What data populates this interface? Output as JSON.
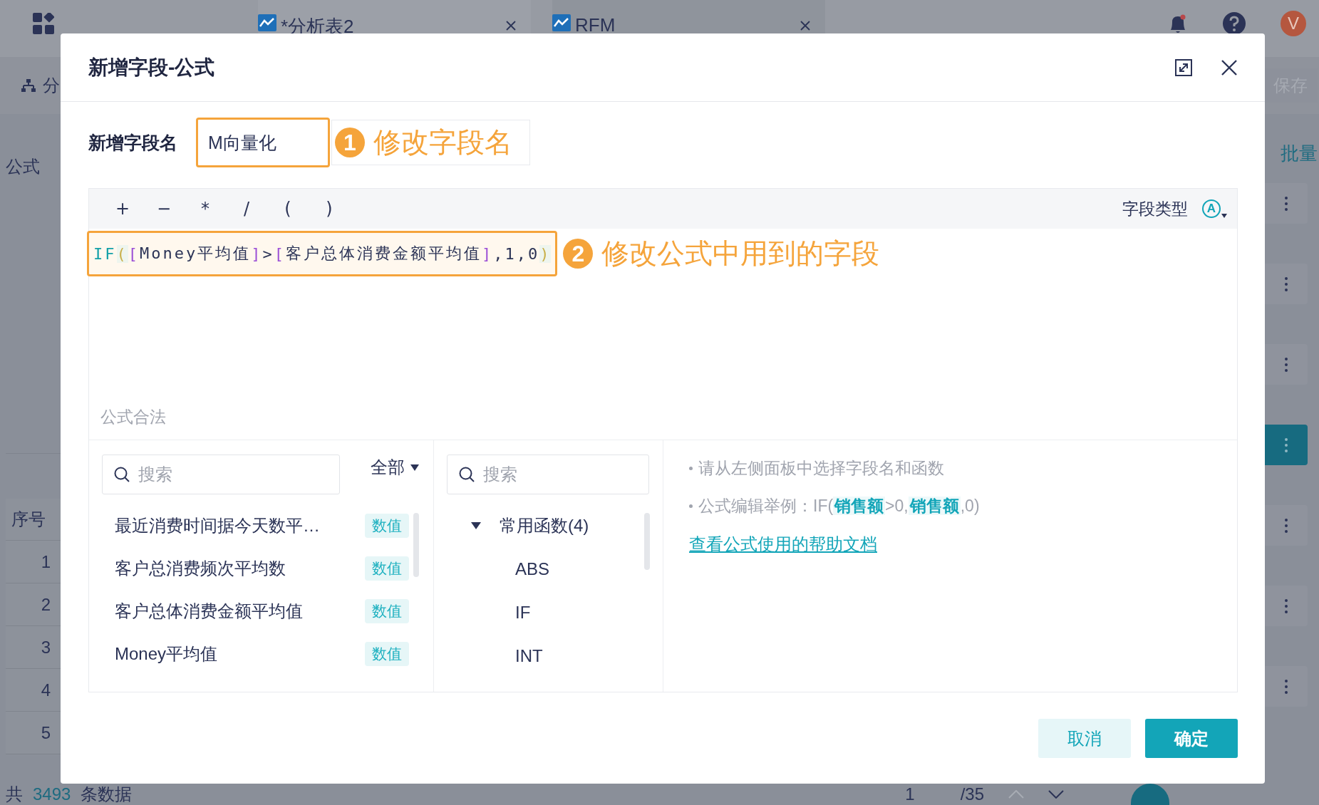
{
  "app": {
    "tabs": [
      {
        "label": "*分析表2",
        "selected": true
      },
      {
        "label": "RFM",
        "selected": false
      }
    ],
    "avatar": "V",
    "toolbar_label": "分",
    "save_button": "保存",
    "side_label": "公式",
    "batch_label": "批量",
    "table": {
      "header": "序号",
      "rows": [
        "1",
        "2",
        "3",
        "4",
        "5"
      ]
    },
    "row_actions": [
      {
        "selected": false
      },
      {
        "selected": false
      },
      {
        "selected": false
      },
      {
        "selected": true
      },
      {
        "selected": false
      },
      {
        "selected": false
      },
      {
        "selected": false
      }
    ],
    "footer": {
      "prefix": "共",
      "count": "3493",
      "suffix": "条数据"
    },
    "pagination": {
      "page": "1",
      "total": "/35"
    }
  },
  "dialog": {
    "title": "新增字段-公式",
    "field_name": {
      "label": "新增字段名",
      "value": "M向量化"
    },
    "annotations": [
      {
        "number": "1",
        "text": "修改字段名"
      },
      {
        "number": "2",
        "text": "修改公式中用到的字段"
      }
    ],
    "operators": [
      "+",
      "−",
      "*",
      "/",
      "(",
      ")"
    ],
    "field_type": {
      "label": "字段类型",
      "icon_letter": "A"
    },
    "formula": [
      {
        "kind": "func",
        "text": "IF"
      },
      {
        "kind": "paren",
        "text": "("
      },
      {
        "kind": "bracket",
        "text": "["
      },
      {
        "kind": "plain",
        "text": "Money平均值"
      },
      {
        "kind": "bracket",
        "text": "]"
      },
      {
        "kind": "plain",
        "text": ">"
      },
      {
        "kind": "bracket",
        "text": "["
      },
      {
        "kind": "plain",
        "text": "客户总体消费金额平均值"
      },
      {
        "kind": "bracket",
        "text": "]"
      },
      {
        "kind": "plain",
        "text": ",1,0"
      },
      {
        "kind": "paren",
        "text": ")"
      }
    ],
    "status": "公式合法",
    "field_search": {
      "placeholder": "搜索"
    },
    "filter": "全部",
    "fields": [
      {
        "name": "最近消费时间据今天数平…",
        "type": "数值"
      },
      {
        "name": "客户总消费频次平均数",
        "type": "数值"
      },
      {
        "name": "客户总体消费金额平均值",
        "type": "数值"
      },
      {
        "name": "Money平均值",
        "type": "数值"
      }
    ],
    "function_search": {
      "placeholder": "搜索"
    },
    "function_group": {
      "label": "常用函数(4)",
      "expanded": true,
      "children": [
        "ABS",
        "IF",
        "INT"
      ]
    },
    "hint": "请从左侧面板中选择字段名和函数",
    "example": [
      {
        "kind": "text",
        "text": "公式编辑举例：IF("
      },
      {
        "kind": "field",
        "text": "销售额"
      },
      {
        "kind": "text",
        "text": ">0,"
      },
      {
        "kind": "field",
        "text": "销售额"
      },
      {
        "kind": "text",
        "text": ",0)"
      }
    ],
    "help_link": "查看公式使用的帮助文档",
    "buttons": {
      "cancel": "取消",
      "ok": "确定"
    }
  }
}
